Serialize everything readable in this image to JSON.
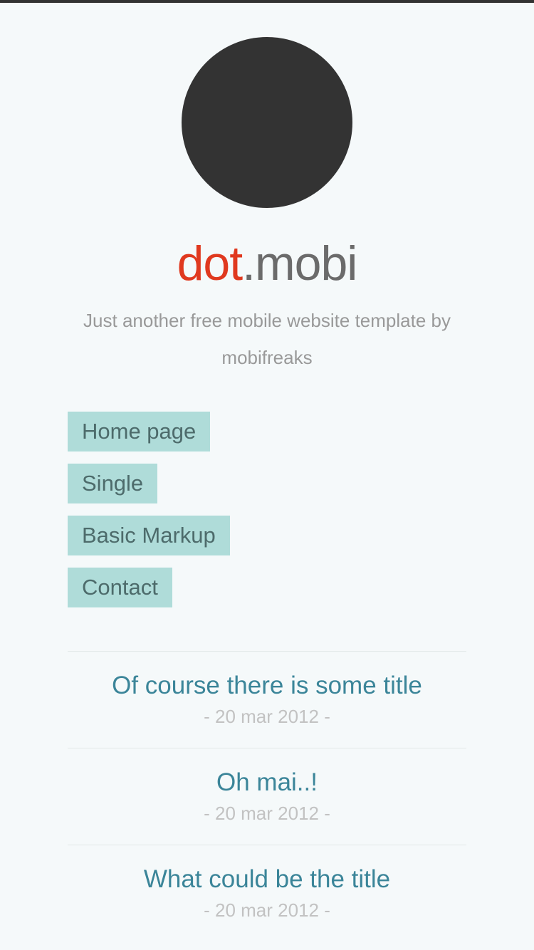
{
  "site": {
    "title_highlight": "dot",
    "title_rest": ".mobi",
    "tagline": "Just another free mobile website template by mobifreaks"
  },
  "nav": {
    "items": [
      {
        "label": "Home page"
      },
      {
        "label": "Single"
      },
      {
        "label": "Basic Markup"
      },
      {
        "label": "Contact"
      }
    ]
  },
  "posts": [
    {
      "title": "Of course there is some title",
      "date": "- 20 mar 2012 -"
    },
    {
      "title": "Oh mai..!",
      "date": "- 20 mar 2012 -"
    },
    {
      "title": "What could be the title",
      "date": "- 20 mar 2012 -"
    }
  ],
  "colors": {
    "accent_red": "#e0391f",
    "nav_bg": "#afdcd9",
    "post_title": "#3b8599",
    "logo": "#333333"
  }
}
